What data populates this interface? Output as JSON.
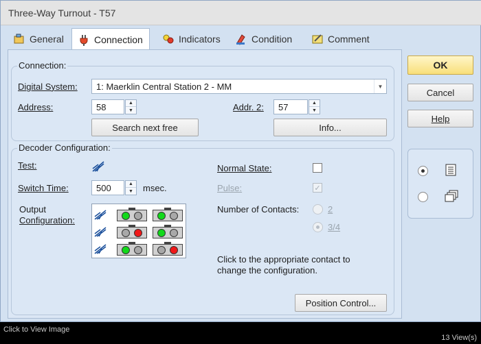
{
  "window": {
    "title": "Three-Way Turnout - T57"
  },
  "tabs": [
    {
      "label": "General",
      "icon": "general-icon"
    },
    {
      "label": "Connection",
      "icon": "plug-icon"
    },
    {
      "label": "Indicators",
      "icon": "indicators-icon"
    },
    {
      "label": "Condition",
      "icon": "condition-icon"
    },
    {
      "label": "Comment",
      "icon": "comment-icon"
    }
  ],
  "connection": {
    "group_label": "Connection:",
    "digital_system_label": "Digital System:",
    "digital_system_value": "1: Maerklin Central Station 2 - MM",
    "address_label": "Address:",
    "address_value": "58",
    "addr2_label": "Addr. 2:",
    "addr2_value": "57",
    "search_button": "Search next free",
    "info_button": "Info..."
  },
  "decoder": {
    "group_label": "Decoder Configuration:",
    "test_label": "Test:",
    "switch_time_label": "Switch Time:",
    "switch_time_value": "500",
    "switch_time_unit": "msec.",
    "output_label_line1": "Output",
    "output_label_line2": "Configuration:",
    "normal_state_label": "Normal State:",
    "normal_state_checked": false,
    "pulse_label": "Pulse:",
    "pulse_checked": true,
    "contacts_label": "Number of Contacts:",
    "contacts_option_2": "2",
    "contacts_option_34": "3/4",
    "contacts_selected": "3/4",
    "hint_line1": "Click to the appropriate contact to",
    "hint_line2": "change the configuration.",
    "position_control_button": "Position Control..."
  },
  "output_rows": [
    {
      "left": [
        "green",
        "grey"
      ],
      "right": [
        "green",
        "grey"
      ]
    },
    {
      "left": [
        "grey",
        "red"
      ],
      "right": [
        "green",
        "grey"
      ]
    },
    {
      "left": [
        "green",
        "grey"
      ],
      "right": [
        "grey",
        "red"
      ]
    }
  ],
  "buttons": {
    "ok": "OK",
    "cancel": "Cancel",
    "help": "Help"
  },
  "view_options": {
    "selected": "single-window"
  },
  "statusbar": {
    "left": "Click to View Image",
    "right": "13 View(s)"
  }
}
